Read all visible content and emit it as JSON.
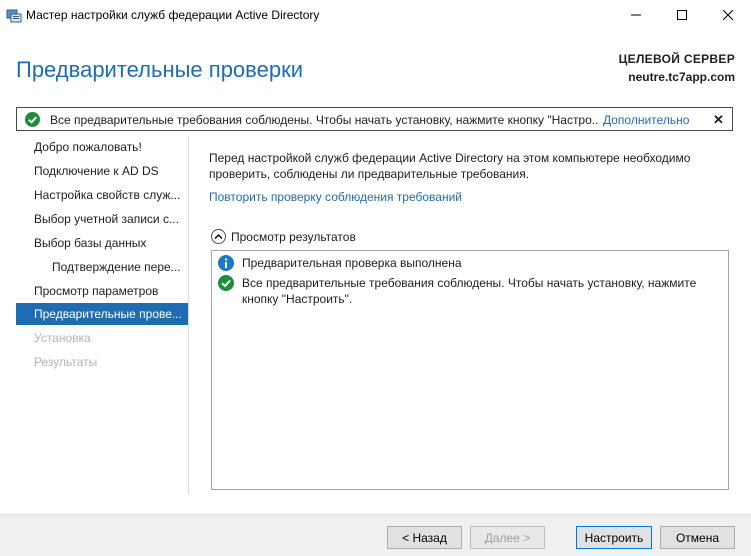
{
  "window": {
    "title": "Мастер настройки служб федерации Active Directory",
    "app_icon": "adfs-server-icon",
    "controls": [
      "minimize-icon",
      "maximize-icon",
      "close-icon"
    ]
  },
  "header": {
    "page_title": "Предварительные проверки",
    "target_label": "ЦЕЛЕВОЙ СЕРВЕР",
    "target_host": "neutre.tc7app.com"
  },
  "notification": {
    "icon": "success-check-icon",
    "text": "Все предварительные требования соблюдены. Чтобы начать установку, нажмите кнопку \"Настро...",
    "more_link": "Дополнительно",
    "close": "✕"
  },
  "nav": {
    "items": [
      {
        "label": "Добро пожаловать!",
        "state": "normal"
      },
      {
        "label": "Подключение к AD DS",
        "state": "normal"
      },
      {
        "label": "Настройка свойств служ...",
        "state": "normal"
      },
      {
        "label": "Выбор учетной записи с...",
        "state": "normal"
      },
      {
        "label": "Выбор базы данных",
        "state": "normal"
      },
      {
        "label": "Подтверждение пере...",
        "state": "sub"
      },
      {
        "label": "Просмотр параметров",
        "state": "normal"
      },
      {
        "label": "Предварительные прове...",
        "state": "active"
      },
      {
        "label": "Установка",
        "state": "disabled"
      },
      {
        "label": "Результаты",
        "state": "disabled"
      }
    ]
  },
  "content": {
    "description": "Перед настройкой служб федерации Active Directory на этом компьютере необходимо проверить, соблюдены ли предварительные требования.",
    "rerun_link": "Повторить проверку соблюдения требований",
    "results_header": "Просмотр результатов",
    "results": [
      {
        "icon": "info-icon",
        "text": "Предварительная проверка выполнена"
      },
      {
        "icon": "success-check-icon",
        "text": "Все предварительные требования соблюдены. Чтобы начать установку, нажмите кнопку \"Настроить\"."
      }
    ]
  },
  "footer": {
    "back_label": "< Назад",
    "next_label": "Далее >",
    "configure_label": "Настроить",
    "cancel_label": "Отмена"
  },
  "colors": {
    "accent": "#1e6db3",
    "success": "#1e8e3e",
    "info": "#1e78c8",
    "disabled_text": "#b4b4b4"
  }
}
